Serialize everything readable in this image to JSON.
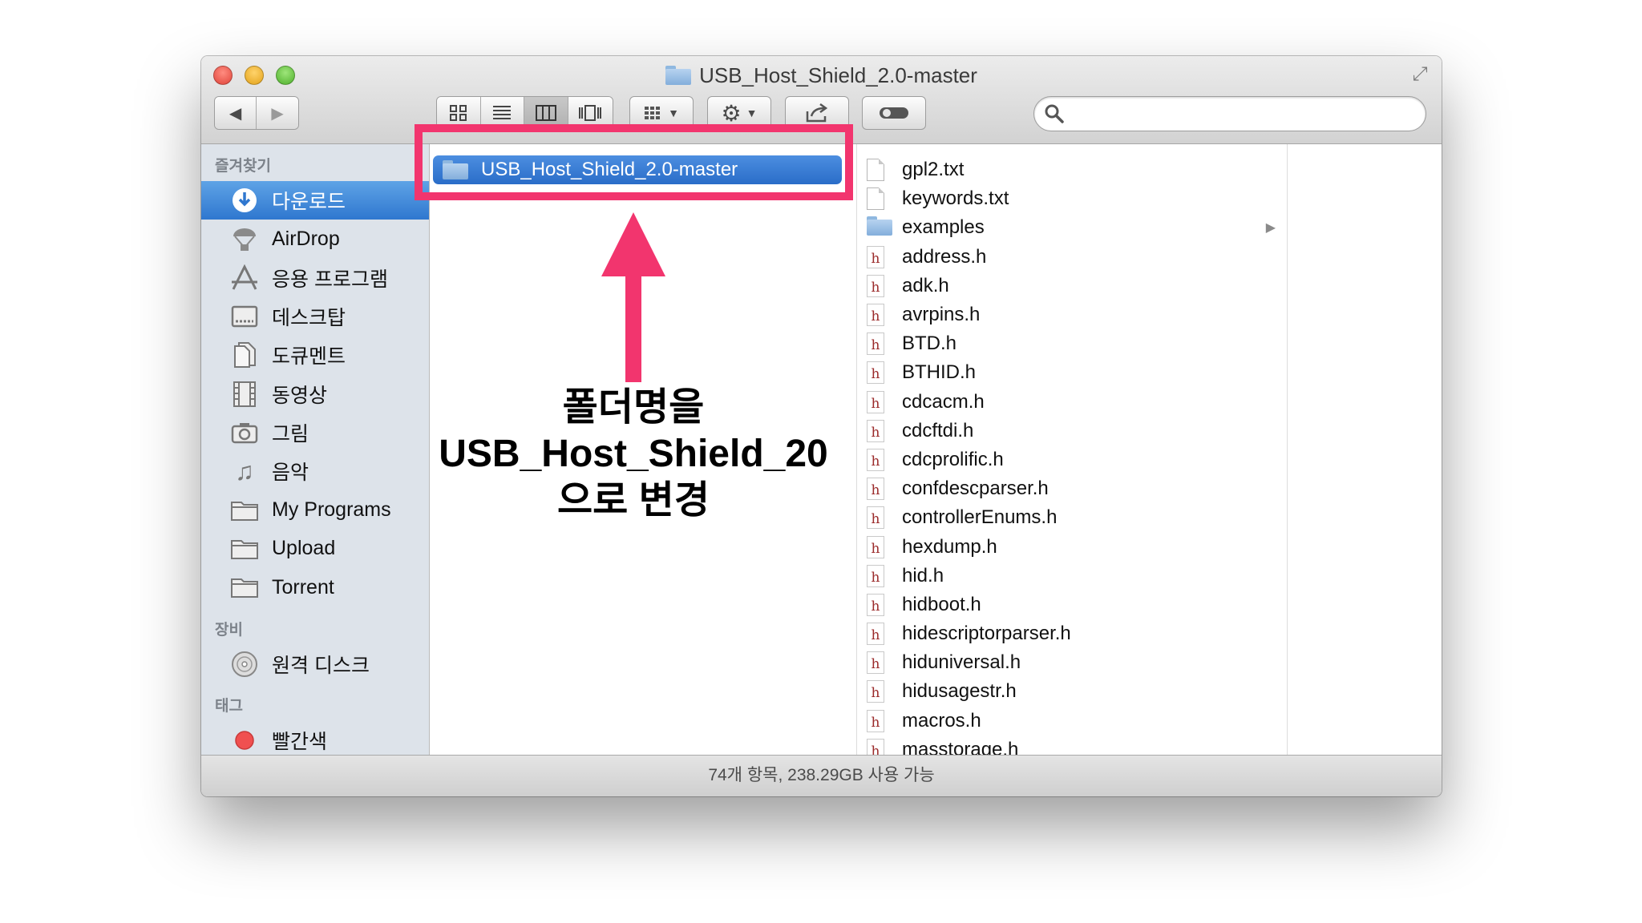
{
  "window": {
    "title": "USB_Host_Shield_2.0-master"
  },
  "toolbar": {
    "back_icon": "back-arrow-icon",
    "forward_icon": "forward-arrow-icon",
    "view_modes": [
      "icon-view",
      "list-view",
      "column-view",
      "cover-flow-view"
    ],
    "active_view": "column-view",
    "search_placeholder": ""
  },
  "sidebar": {
    "favorites_header": "즐겨찾기",
    "favorites": [
      {
        "label": "다운로드",
        "icon": "downloads-icon",
        "selected": true
      },
      {
        "label": "AirDrop",
        "icon": "airdrop-icon"
      },
      {
        "label": "응용 프로그램",
        "icon": "applications-icon"
      },
      {
        "label": "데스크탑",
        "icon": "desktop-icon"
      },
      {
        "label": "도큐멘트",
        "icon": "documents-icon"
      },
      {
        "label": "동영상",
        "icon": "movies-icon"
      },
      {
        "label": "그림",
        "icon": "pictures-icon"
      },
      {
        "label": "음악",
        "icon": "music-icon"
      },
      {
        "label": "My Programs",
        "icon": "folder-icon"
      },
      {
        "label": "Upload",
        "icon": "folder-icon"
      },
      {
        "label": "Torrent",
        "icon": "folder-icon"
      }
    ],
    "devices_header": "장비",
    "devices": [
      {
        "label": "원격 디스크",
        "icon": "remote-disc-icon"
      }
    ],
    "tags_header": "태그",
    "tags": [
      {
        "label": "빨간색",
        "color": "#f05050"
      }
    ]
  },
  "column1": {
    "selected_folder": "USB_Host_Shield_2.0-master"
  },
  "column2": {
    "files": [
      {
        "name": "gpl2.txt",
        "kind": "text"
      },
      {
        "name": "keywords.txt",
        "kind": "text"
      },
      {
        "name": "examples",
        "kind": "folder"
      },
      {
        "name": "address.h",
        "kind": "h"
      },
      {
        "name": "adk.h",
        "kind": "h"
      },
      {
        "name": "avrpins.h",
        "kind": "h"
      },
      {
        "name": "BTD.h",
        "kind": "h"
      },
      {
        "name": "BTHID.h",
        "kind": "h"
      },
      {
        "name": "cdcacm.h",
        "kind": "h"
      },
      {
        "name": "cdcftdi.h",
        "kind": "h"
      },
      {
        "name": "cdcprolific.h",
        "kind": "h"
      },
      {
        "name": "confdescparser.h",
        "kind": "h"
      },
      {
        "name": "controllerEnums.h",
        "kind": "h"
      },
      {
        "name": "hexdump.h",
        "kind": "h"
      },
      {
        "name": "hid.h",
        "kind": "h"
      },
      {
        "name": "hidboot.h",
        "kind": "h"
      },
      {
        "name": "hidescriptorparser.h",
        "kind": "h"
      },
      {
        "name": "hiduniversal.h",
        "kind": "h"
      },
      {
        "name": "hidusagestr.h",
        "kind": "h"
      },
      {
        "name": "macros.h",
        "kind": "h"
      },
      {
        "name": "masstorage.h",
        "kind": "h"
      }
    ]
  },
  "statusbar": {
    "text": "74개 항목, 238.29GB 사용 가능"
  },
  "annotation": {
    "lines": [
      "폴더명을",
      "USB_Host_Shield_20",
      "으로 변경"
    ],
    "color": "#f2356e"
  }
}
